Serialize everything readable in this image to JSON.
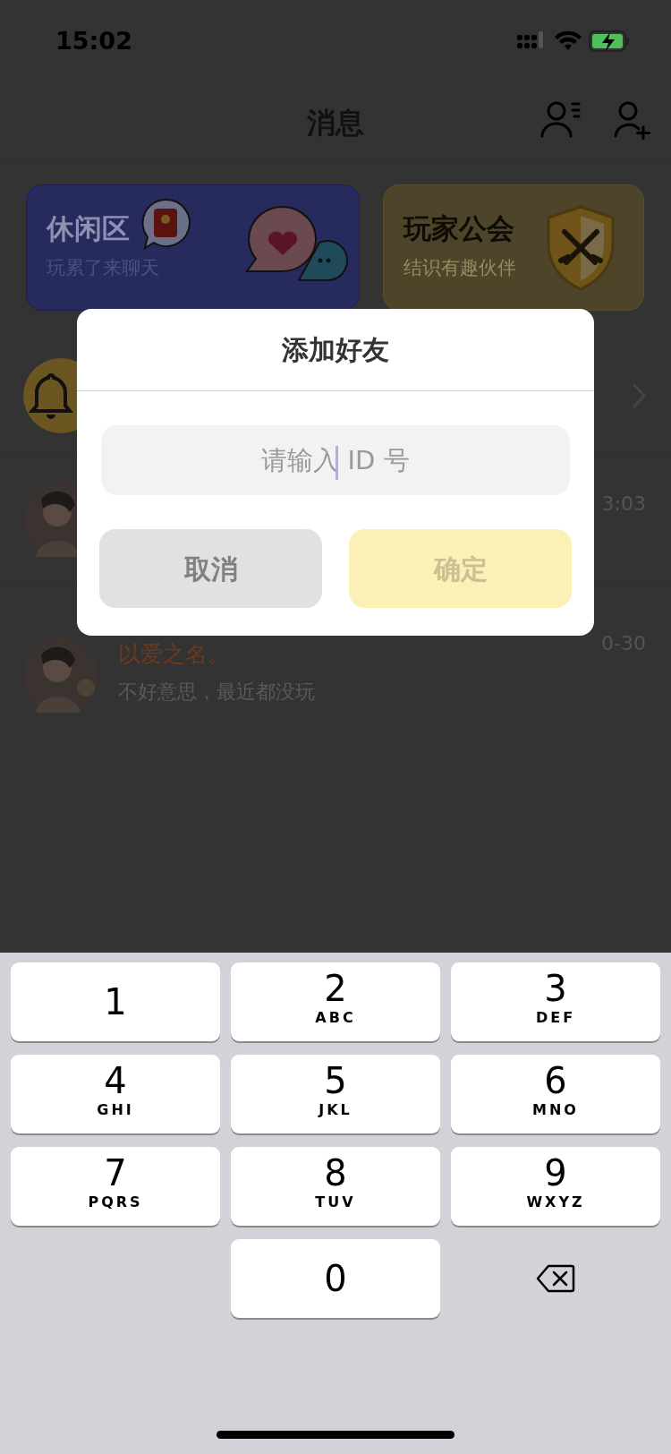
{
  "status_bar": {
    "time": "15:02"
  },
  "nav": {
    "title": "消息"
  },
  "cards": [
    {
      "kind": "lounge",
      "title": "休闲区",
      "subtitle": "玩累了来聊天"
    },
    {
      "kind": "guild",
      "title": "玩家公会",
      "subtitle": "结识有趣伙伴"
    }
  ],
  "messages": [
    {
      "kind": "notice"
    },
    {
      "kind": "chat",
      "time": "3:03"
    },
    {
      "kind": "chat",
      "name": "以爱之名。",
      "preview": "不好意思，最近都没玩",
      "time": "0-30"
    }
  ],
  "dialog": {
    "title": "添加好友",
    "input": {
      "placeholder": "请输入 ID 号",
      "focused": true
    },
    "buttons": [
      {
        "kind": "cancel",
        "label": "取消",
        "disabled": false
      },
      {
        "kind": "confirm",
        "label": "确定",
        "disabled": true
      }
    ]
  },
  "keyboard": {
    "keys": [
      {
        "kind": "digit",
        "digit": "1"
      },
      {
        "kind": "digit",
        "digit": "2",
        "letters": "ABC"
      },
      {
        "kind": "digit",
        "digit": "3",
        "letters": "DEF"
      },
      {
        "kind": "digit",
        "digit": "4",
        "letters": "GHI"
      },
      {
        "kind": "digit",
        "digit": "5",
        "letters": "JKL"
      },
      {
        "kind": "digit",
        "digit": "6",
        "letters": "MNO"
      },
      {
        "kind": "digit",
        "digit": "7",
        "letters": "PQRS"
      },
      {
        "kind": "digit",
        "digit": "8",
        "letters": "TUV"
      },
      {
        "kind": "digit",
        "digit": "9",
        "letters": "WXYZ"
      },
      {
        "kind": "blank"
      },
      {
        "kind": "digit",
        "digit": "0"
      },
      {
        "kind": "delete"
      }
    ]
  }
}
